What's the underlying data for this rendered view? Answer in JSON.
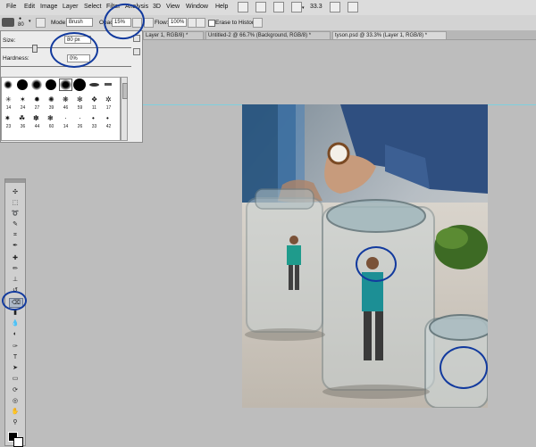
{
  "menubar": {
    "items": [
      "File",
      "Edit",
      "Image",
      "Layer",
      "Select",
      "Filter",
      "Analysis",
      "3D",
      "View",
      "Window",
      "Help"
    ],
    "zoom": "33.3"
  },
  "options": {
    "brush_size": "80",
    "mode_label": "Mode:",
    "mode_value": "Brush",
    "opacity_label": "Opacity:",
    "opacity_value": "15%",
    "flow_label": "Flow:",
    "flow_value": "100%",
    "erase_to_history": "Erase to History"
  },
  "tabs": [
    "Layer 1, RGB/8) *",
    "Untitled-2 @ 66.7% (Background, RGB/8) *",
    "tyson.psd @ 33.3% (Layer 1, RGB/8) *"
  ],
  "brush_panel": {
    "size_label": "Size:",
    "size_value": "80 px",
    "hardness_label": "Hardness:",
    "hardness_value": "0%",
    "row1_numbers": [
      "14",
      "24",
      "27",
      "39",
      "46",
      "59",
      "11",
      "17"
    ],
    "row2_numbers": [
      "23",
      "36",
      "44",
      "60",
      "14",
      "26",
      "33",
      "42"
    ]
  },
  "colors": {
    "annotation": "#123a9e",
    "menubar": "#dcdcdc",
    "workspace": "#bdbdbd"
  }
}
